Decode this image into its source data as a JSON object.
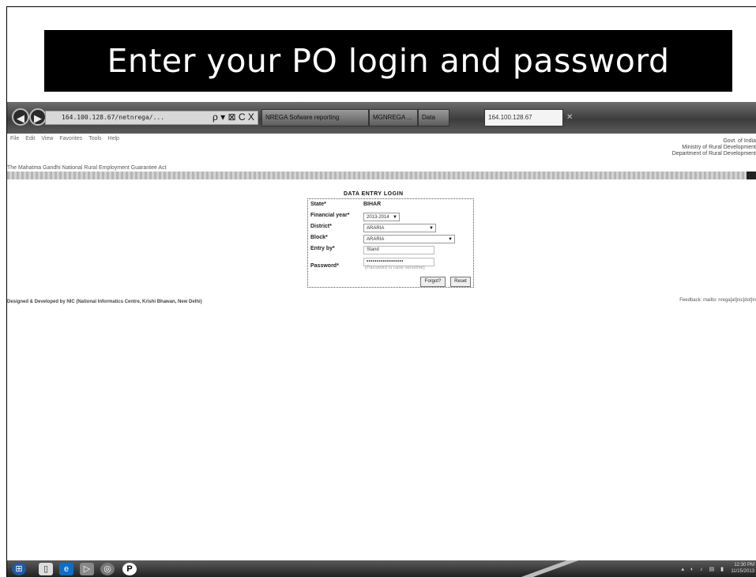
{
  "slide": {
    "title": "Enter your PO login and password"
  },
  "browser": {
    "address": "164.100.128.67/netnrega/...",
    "address_tools": "ρ ▾ ⊠ C X",
    "tabs": [
      {
        "label": "NREGA Sofware reporting"
      },
      {
        "label": "MGNREGA ..."
      },
      {
        "label": "Data"
      },
      {
        "label": "164.100.128.67"
      }
    ],
    "menu": [
      "File",
      "Edit",
      "View",
      "Favorites",
      "Tools",
      "Help"
    ]
  },
  "header": {
    "gov_lines": [
      "Govt. of India",
      "Ministry of Rural Development",
      "Department of Rural Development"
    ],
    "scheme_name": "The Mahatma Gandhi National Rural Employment Guarantee Act"
  },
  "login": {
    "title": "DATA ENTRY LOGIN",
    "fields": {
      "state": {
        "label": "State*",
        "value": "BIHAR"
      },
      "financial_year": {
        "label": "Financial year*",
        "value": "2013-2014"
      },
      "district": {
        "label": "District*",
        "value": "ARARIA"
      },
      "block": {
        "label": "Block*",
        "value": "ARARIA"
      },
      "entry_by": {
        "label": "Entry by*",
        "value": "Stand"
      },
      "password": {
        "label": "Password*",
        "value": "••••••••••••••••••"
      }
    },
    "hint": "(Password is case sensitive)",
    "buttons": {
      "forgot": "Forgot?",
      "reset": "Reset"
    }
  },
  "footer": {
    "left": "Designed & Developed by NIC (National Informatics Centre, Krishi Bhawan, New Delhi)",
    "right": "Feedback: mailto: nrega[at]nic[dot]in"
  },
  "taskbar": {
    "clock_time": "12:30 PM",
    "clock_date": "11/15/2013"
  }
}
